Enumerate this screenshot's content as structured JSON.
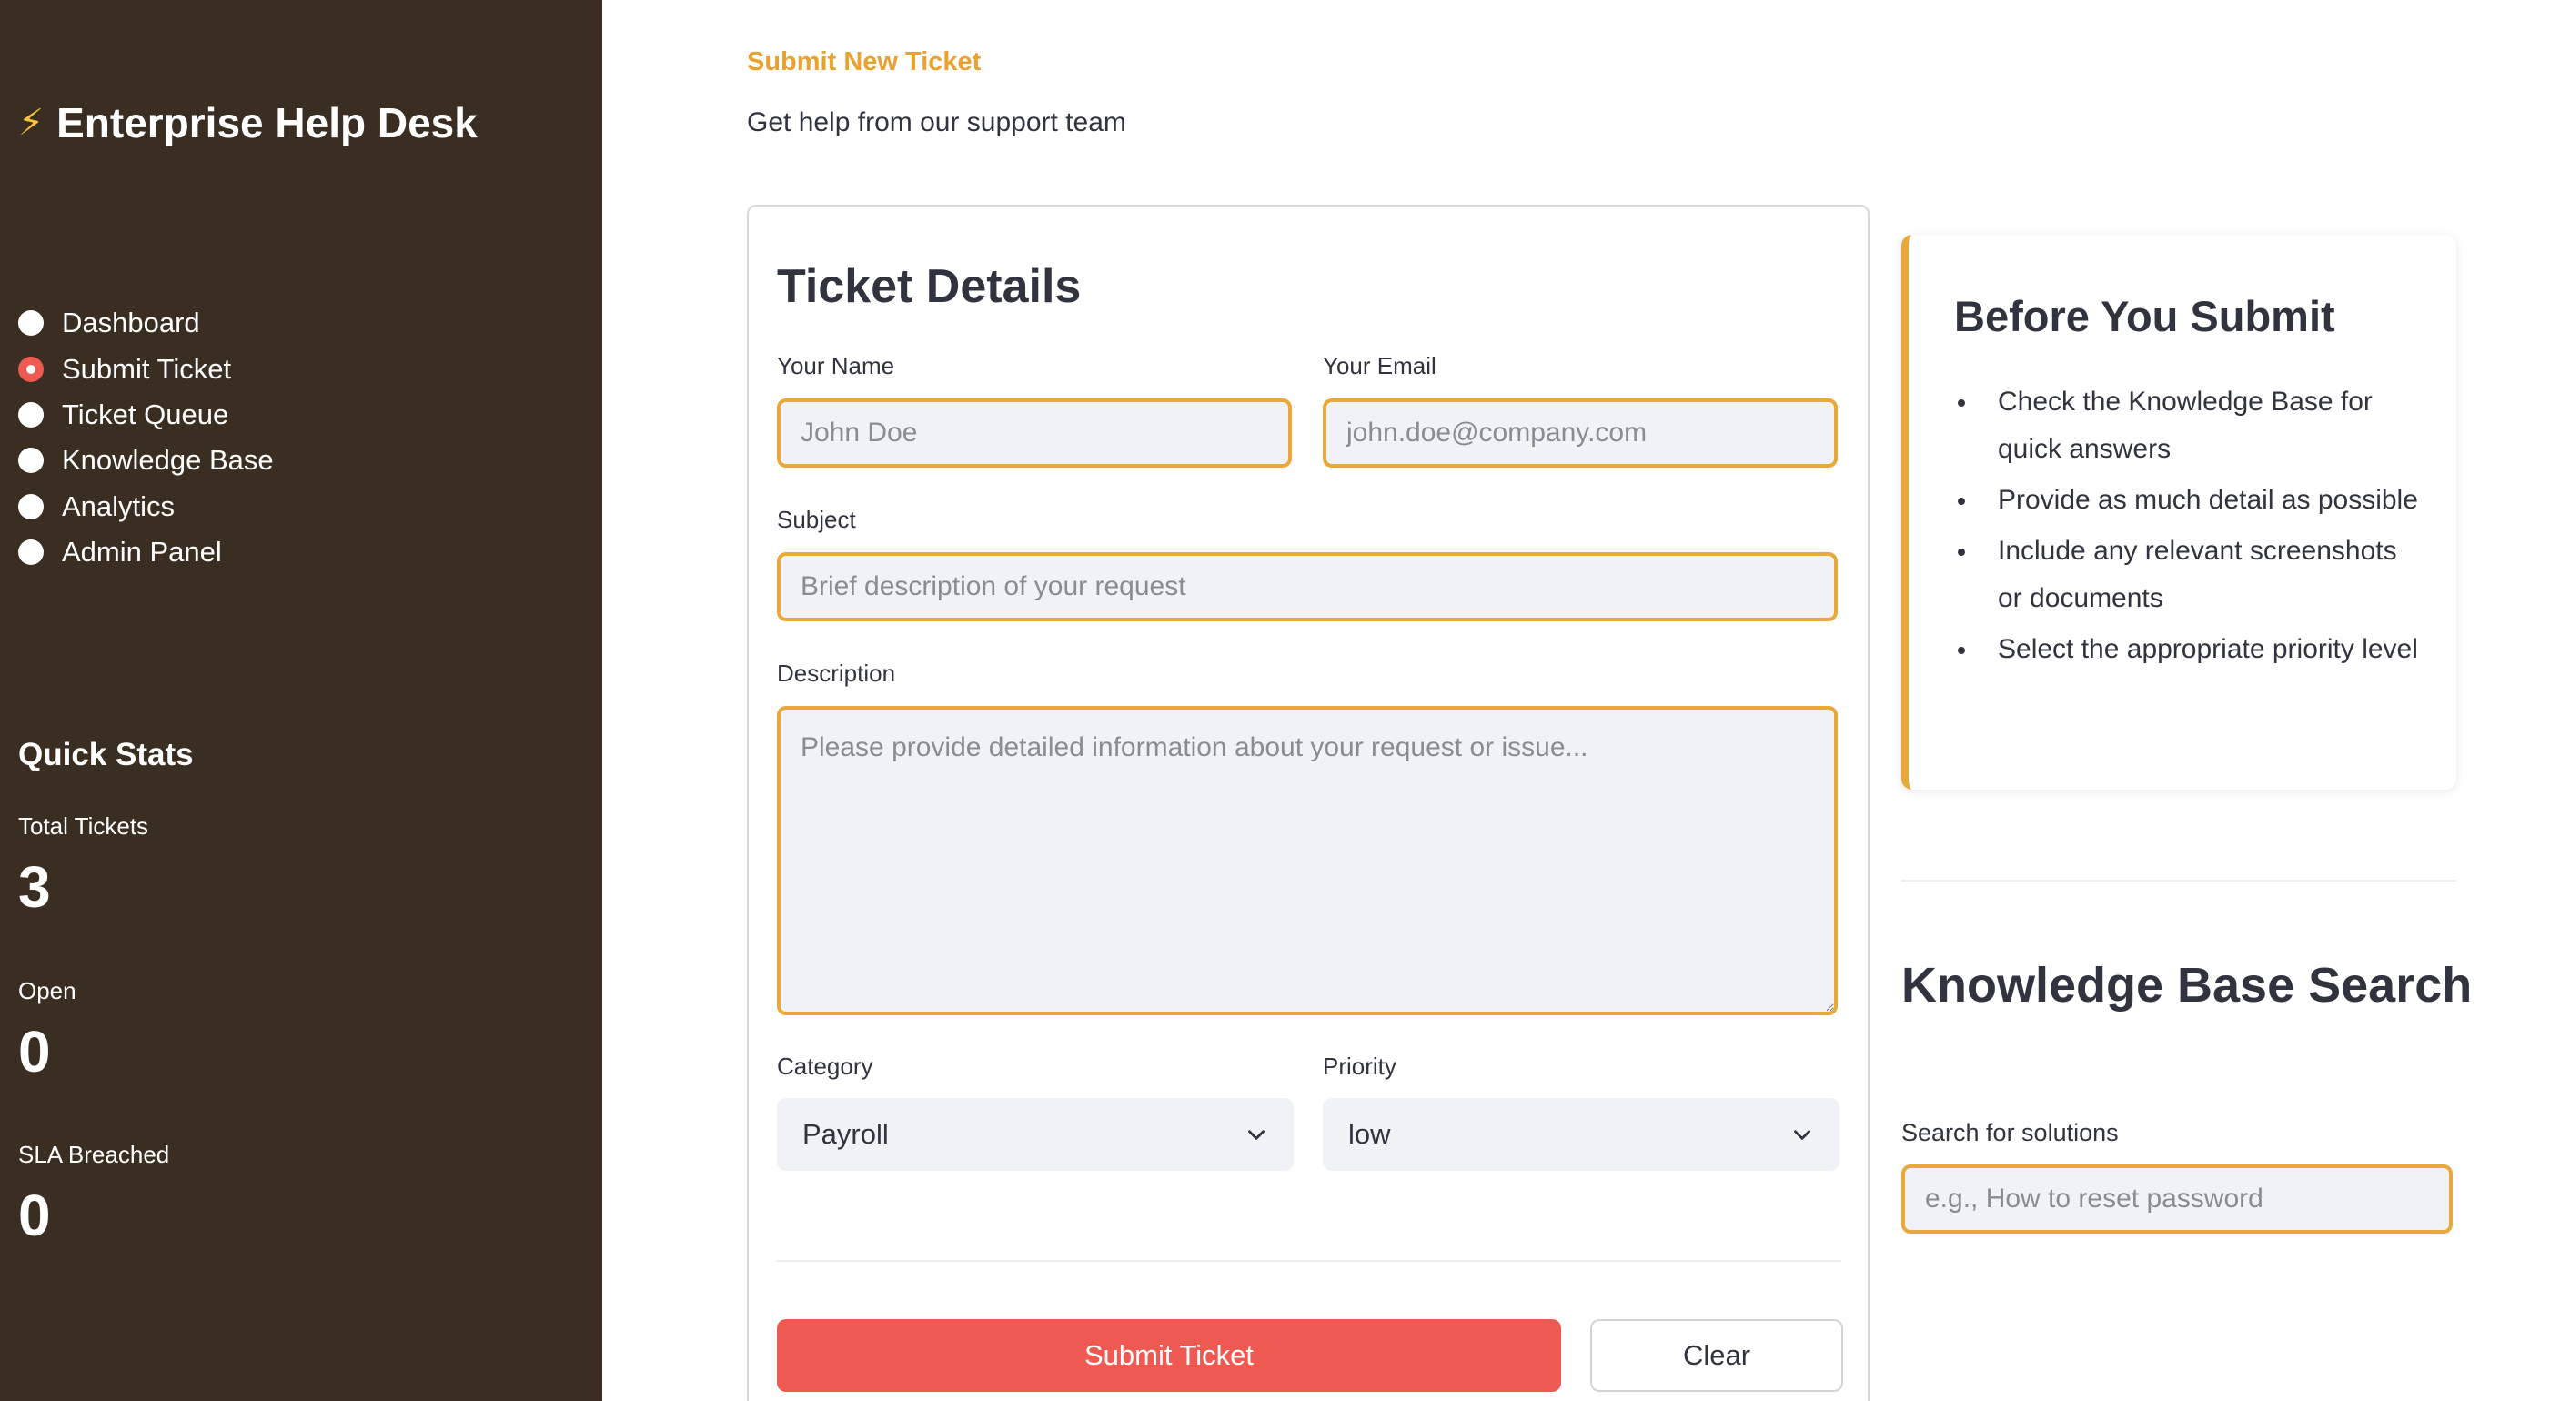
{
  "app": {
    "title": "Enterprise Help Desk",
    "icon": "lightning-bolt-icon"
  },
  "nav": {
    "items": [
      {
        "label": "Dashboard",
        "selected": false
      },
      {
        "label": "Submit Ticket",
        "selected": true
      },
      {
        "label": "Ticket Queue",
        "selected": false
      },
      {
        "label": "Knowledge Base",
        "selected": false
      },
      {
        "label": "Analytics",
        "selected": false
      },
      {
        "label": "Admin Panel",
        "selected": false
      }
    ]
  },
  "quick_stats": {
    "title": "Quick Stats",
    "stats": [
      {
        "label": "Total Tickets",
        "value": "3"
      },
      {
        "label": "Open",
        "value": "0"
      },
      {
        "label": "SLA Breached",
        "value": "0"
      }
    ]
  },
  "page": {
    "kicker": "Submit New Ticket",
    "subtitle": "Get help from our support team"
  },
  "form": {
    "title": "Ticket Details",
    "name": {
      "label": "Your Name",
      "value": "",
      "placeholder": "John Doe"
    },
    "email": {
      "label": "Your Email",
      "value": "",
      "placeholder": "john.doe@company.com"
    },
    "subject": {
      "label": "Subject",
      "value": "",
      "placeholder": "Brief description of your request"
    },
    "description": {
      "label": "Description",
      "value": "",
      "placeholder": "Please provide detailed information about your request or issue..."
    },
    "category": {
      "label": "Category",
      "value": "Payroll"
    },
    "priority": {
      "label": "Priority",
      "value": "low"
    },
    "submit_label": "Submit Ticket",
    "clear_label": "Clear"
  },
  "tips": {
    "title": "Before You Submit",
    "items": [
      "Check the Knowledge Base for quick answers",
      "Provide as much detail as possible",
      "Include any relevant screenshots or documents",
      "Select the appropriate priority level"
    ]
  },
  "kb_search": {
    "title": "Knowledge Base Search",
    "label": "Search for solutions",
    "value": "",
    "placeholder": "e.g., How to reset password"
  },
  "colors": {
    "sidebar_bg": "#3a2e22",
    "accent": "#e9a93a",
    "primary_button": "#ee5a52",
    "kicker": "#e9a230"
  }
}
